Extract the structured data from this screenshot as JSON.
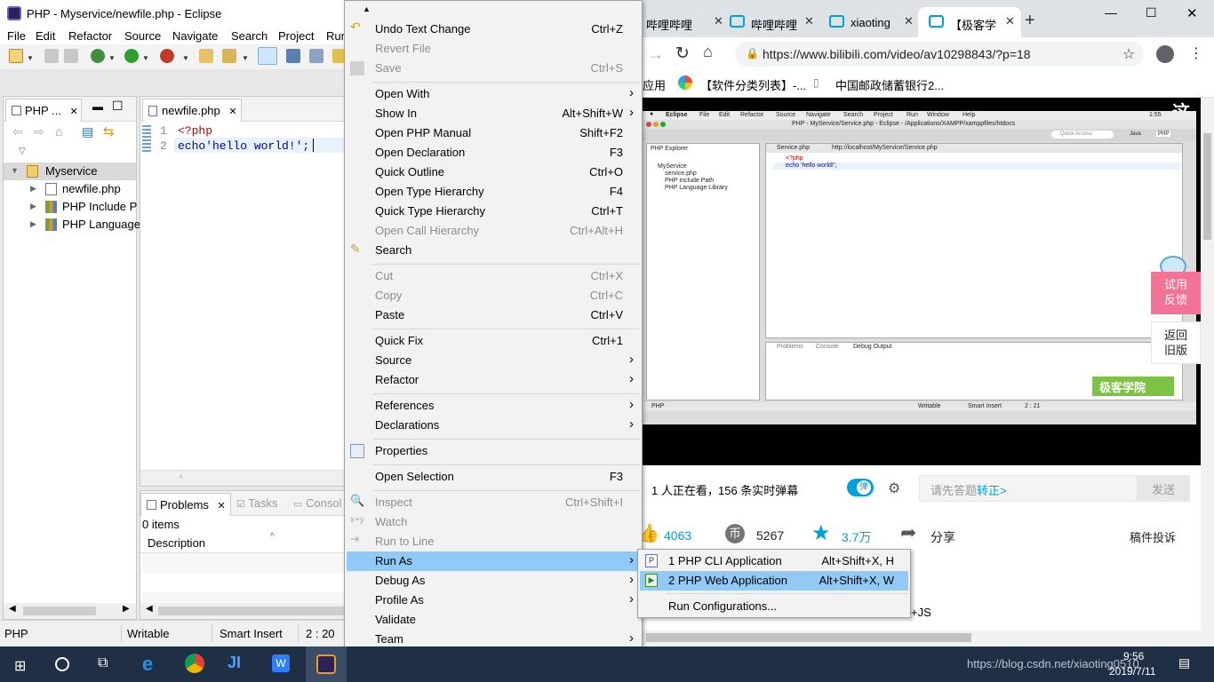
{
  "eclipse": {
    "title": "PHP - Myservice/newfile.php - Eclipse",
    "menubar": [
      "File",
      "Edit",
      "Refactor",
      "Source",
      "Navigate",
      "Search",
      "Project",
      "Run"
    ],
    "explorer": {
      "tab_label": "PHP ...",
      "tree": {
        "project": "Myservice",
        "children": [
          "newfile.php",
          "PHP Include P",
          "PHP Language"
        ]
      }
    },
    "editor": {
      "tab_label": "newfile.php",
      "line_numbers": [
        "1",
        "2"
      ],
      "lines": [
        "<?php",
        "echo'hello world!';"
      ]
    },
    "problems": {
      "tabs": [
        "Problems",
        "Tasks",
        "Consol"
      ],
      "count": "0 items",
      "column": "Description"
    },
    "status": {
      "perspective": "PHP",
      "mode": "Writable",
      "insert": "Smart Insert",
      "position": "2 : 20"
    }
  },
  "context_menu": {
    "items": [
      {
        "label": "Undo Text Change",
        "shortcut": "Ctrl+Z",
        "disabled": false
      },
      {
        "label": "Revert File",
        "shortcut": "",
        "disabled": true
      },
      {
        "label": "Save",
        "shortcut": "Ctrl+S",
        "disabled": true
      },
      {
        "label": "Open With",
        "shortcut": "",
        "disabled": false
      },
      {
        "label": "Show In",
        "shortcut": "Alt+Shift+W",
        "disabled": false
      },
      {
        "label": "Open PHP Manual",
        "shortcut": "Shift+F2",
        "disabled": false
      },
      {
        "label": "Open Declaration",
        "shortcut": "F3",
        "disabled": false
      },
      {
        "label": "Quick Outline",
        "shortcut": "Ctrl+O",
        "disabled": false
      },
      {
        "label": "Open Type Hierarchy",
        "shortcut": "F4",
        "disabled": false
      },
      {
        "label": "Quick Type Hierarchy",
        "shortcut": "Ctrl+T",
        "disabled": false
      },
      {
        "label": "Open Call Hierarchy",
        "shortcut": "Ctrl+Alt+H",
        "disabled": true
      },
      {
        "label": "Search",
        "shortcut": "",
        "disabled": false
      },
      {
        "label": "Cut",
        "shortcut": "Ctrl+X",
        "disabled": true
      },
      {
        "label": "Copy",
        "shortcut": "Ctrl+C",
        "disabled": true
      },
      {
        "label": "Paste",
        "shortcut": "Ctrl+V",
        "disabled": false
      },
      {
        "label": "Quick Fix",
        "shortcut": "Ctrl+1",
        "disabled": false
      },
      {
        "label": "Source",
        "shortcut": "",
        "disabled": false
      },
      {
        "label": "Refactor",
        "shortcut": "",
        "disabled": false
      },
      {
        "label": "References",
        "shortcut": "",
        "disabled": false
      },
      {
        "label": "Declarations",
        "shortcut": "",
        "disabled": false
      },
      {
        "label": "Properties",
        "shortcut": "",
        "disabled": false
      },
      {
        "label": "Open Selection",
        "shortcut": "F3",
        "disabled": false
      },
      {
        "label": "Inspect",
        "shortcut": "Ctrl+Shift+I",
        "disabled": true
      },
      {
        "label": "Watch",
        "shortcut": "",
        "disabled": true
      },
      {
        "label": "Run to Line",
        "shortcut": "",
        "disabled": true
      },
      {
        "label": "Run As",
        "shortcut": "",
        "disabled": false
      },
      {
        "label": "Debug As",
        "shortcut": "",
        "disabled": false
      },
      {
        "label": "Profile As",
        "shortcut": "",
        "disabled": false
      },
      {
        "label": "Validate",
        "shortcut": "",
        "disabled": false
      },
      {
        "label": "Team",
        "shortcut": "",
        "disabled": false
      }
    ]
  },
  "run_as_submenu": {
    "items": [
      {
        "label": "1 PHP CLI Application",
        "shortcut": "Alt+Shift+X, H"
      },
      {
        "label": "2 PHP Web Application",
        "shortcut": "Alt+Shift+X, W"
      },
      {
        "label": "Run Configurations...",
        "shortcut": ""
      }
    ]
  },
  "browser": {
    "tabs": [
      "哔哩哔哩",
      "哔哩哔哩",
      "xiaoting",
      "【极客学"
    ],
    "url": "https://www.bilibili.com/video/av10298843/?p=18",
    "bookmarks": [
      "应用",
      "【软件分类列表】-...",
      "中国邮政储蓄银行2..."
    ],
    "video_inner": {
      "menubar": [
        "Eclipse",
        "File",
        "Edit",
        "Refactor",
        "Source",
        "Navigate",
        "Search",
        "Project",
        "Run",
        "Window",
        "Help"
      ],
      "title": "PHP - MyService/Service.php - Eclipse - /Applications/XAMPP/xamppfiles/htdocs",
      "time": "1:55",
      "quick_access": "Quick Access",
      "explorer_tab": "PHP Explorer",
      "tree": [
        "MyService",
        "service.php",
        "PHP Include Path",
        "PHP Language Library"
      ],
      "editor_tab": "Service.php",
      "browser_tab": "http://localhost/MyService/Service.php",
      "code": [
        "<?php",
        "echo 'hello world!';"
      ],
      "bottom_tabs": [
        "Problems",
        "Console",
        "Debug Output"
      ],
      "status": [
        "PHP",
        "Writable",
        "Smart Insert",
        "2 : 21"
      ],
      "perspectives": [
        "Java",
        "PHP"
      ],
      "logo": "极客学院"
    },
    "side_buttons": {
      "feedback": "试用\n反馈",
      "back": "返回\n旧版"
    },
    "viewers": "1 人正在看，",
    "danmaku": "156 条实时弹幕",
    "danmu_toggle": "弹",
    "danmu_placeholder": "请先答题",
    "danmu_link": "转正>",
    "send": "发送",
    "likes": "4063",
    "coins": "5267",
    "favorites": "3.7万",
    "share": "分享",
    "report": "稿件投诉",
    "below_text": "+JS"
  },
  "taskbar": {
    "time": "9:56",
    "date": "2019/7/11",
    "watermark": "https://blog.csdn.net/xiaoting0510"
  },
  "colors": {
    "menu_highlight": "#91c9f7",
    "bili_blue": "#00a1d6",
    "taskbar": "#1f3046"
  }
}
